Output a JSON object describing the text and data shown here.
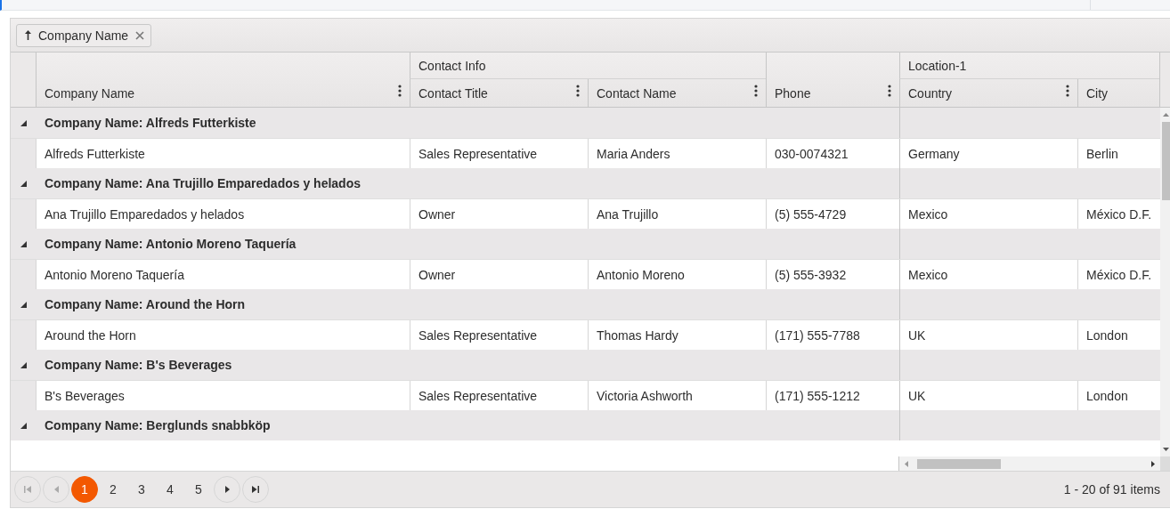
{
  "group_panel": {
    "chips": [
      {
        "label": "Company Name",
        "ascending": true
      }
    ]
  },
  "column_groups": [
    {
      "columns": [
        {
          "label": "Company Name",
          "menu": true
        }
      ]
    },
    {
      "label": "Contact Info",
      "columns": [
        {
          "label": "Contact Title",
          "menu": true
        },
        {
          "label": "Contact Name",
          "menu": true
        }
      ]
    },
    {
      "columns": [
        {
          "label": "Phone",
          "menu": true
        }
      ]
    },
    {
      "label": "Location-1",
      "columns": [
        {
          "label": "Country",
          "menu": true
        },
        {
          "label": "City"
        }
      ]
    }
  ],
  "groups": [
    {
      "header": "Company Name: Alfreds Futterkiste",
      "expanded": true,
      "rows": [
        [
          "Alfreds Futterkiste",
          "Sales Representative",
          "Maria Anders",
          "030-0074321",
          "Germany",
          "Berlin"
        ]
      ]
    },
    {
      "header": "Company Name: Ana Trujillo Emparedados y helados",
      "expanded": true,
      "rows": [
        [
          "Ana Trujillo Emparedados y helados",
          "Owner",
          "Ana Trujillo",
          "(5) 555-4729",
          "Mexico",
          "México D.F."
        ]
      ]
    },
    {
      "header": "Company Name: Antonio Moreno Taquería",
      "expanded": true,
      "rows": [
        [
          "Antonio Moreno Taquería",
          "Owner",
          "Antonio Moreno",
          "(5) 555-3932",
          "Mexico",
          "México D.F."
        ]
      ]
    },
    {
      "header": "Company Name: Around the Horn",
      "expanded": true,
      "rows": [
        [
          "Around the Horn",
          "Sales Representative",
          "Thomas Hardy",
          "(171) 555-7788",
          "UK",
          "London"
        ]
      ]
    },
    {
      "header": "Company Name: B's Beverages",
      "expanded": true,
      "rows": [
        [
          "B's Beverages",
          "Sales Representative",
          "Victoria Ashworth",
          "(171) 555-1212",
          "UK",
          "London"
        ]
      ]
    },
    {
      "header": "Company Name: Berglunds snabbköp",
      "expanded": true
    }
  ],
  "pager": {
    "nav": [
      {
        "kind": "first",
        "disabled": true
      },
      {
        "kind": "prev",
        "disabled": true
      },
      {
        "kind": "next",
        "disabled": false
      },
      {
        "kind": "last",
        "disabled": false
      }
    ],
    "pages": [
      {
        "label": "1",
        "selected": true
      },
      {
        "label": "2",
        "selected": false
      },
      {
        "label": "3",
        "selected": false
      },
      {
        "label": "4",
        "selected": false
      },
      {
        "label": "5",
        "selected": false
      }
    ],
    "summary": "1 - 20 of 91 items"
  }
}
